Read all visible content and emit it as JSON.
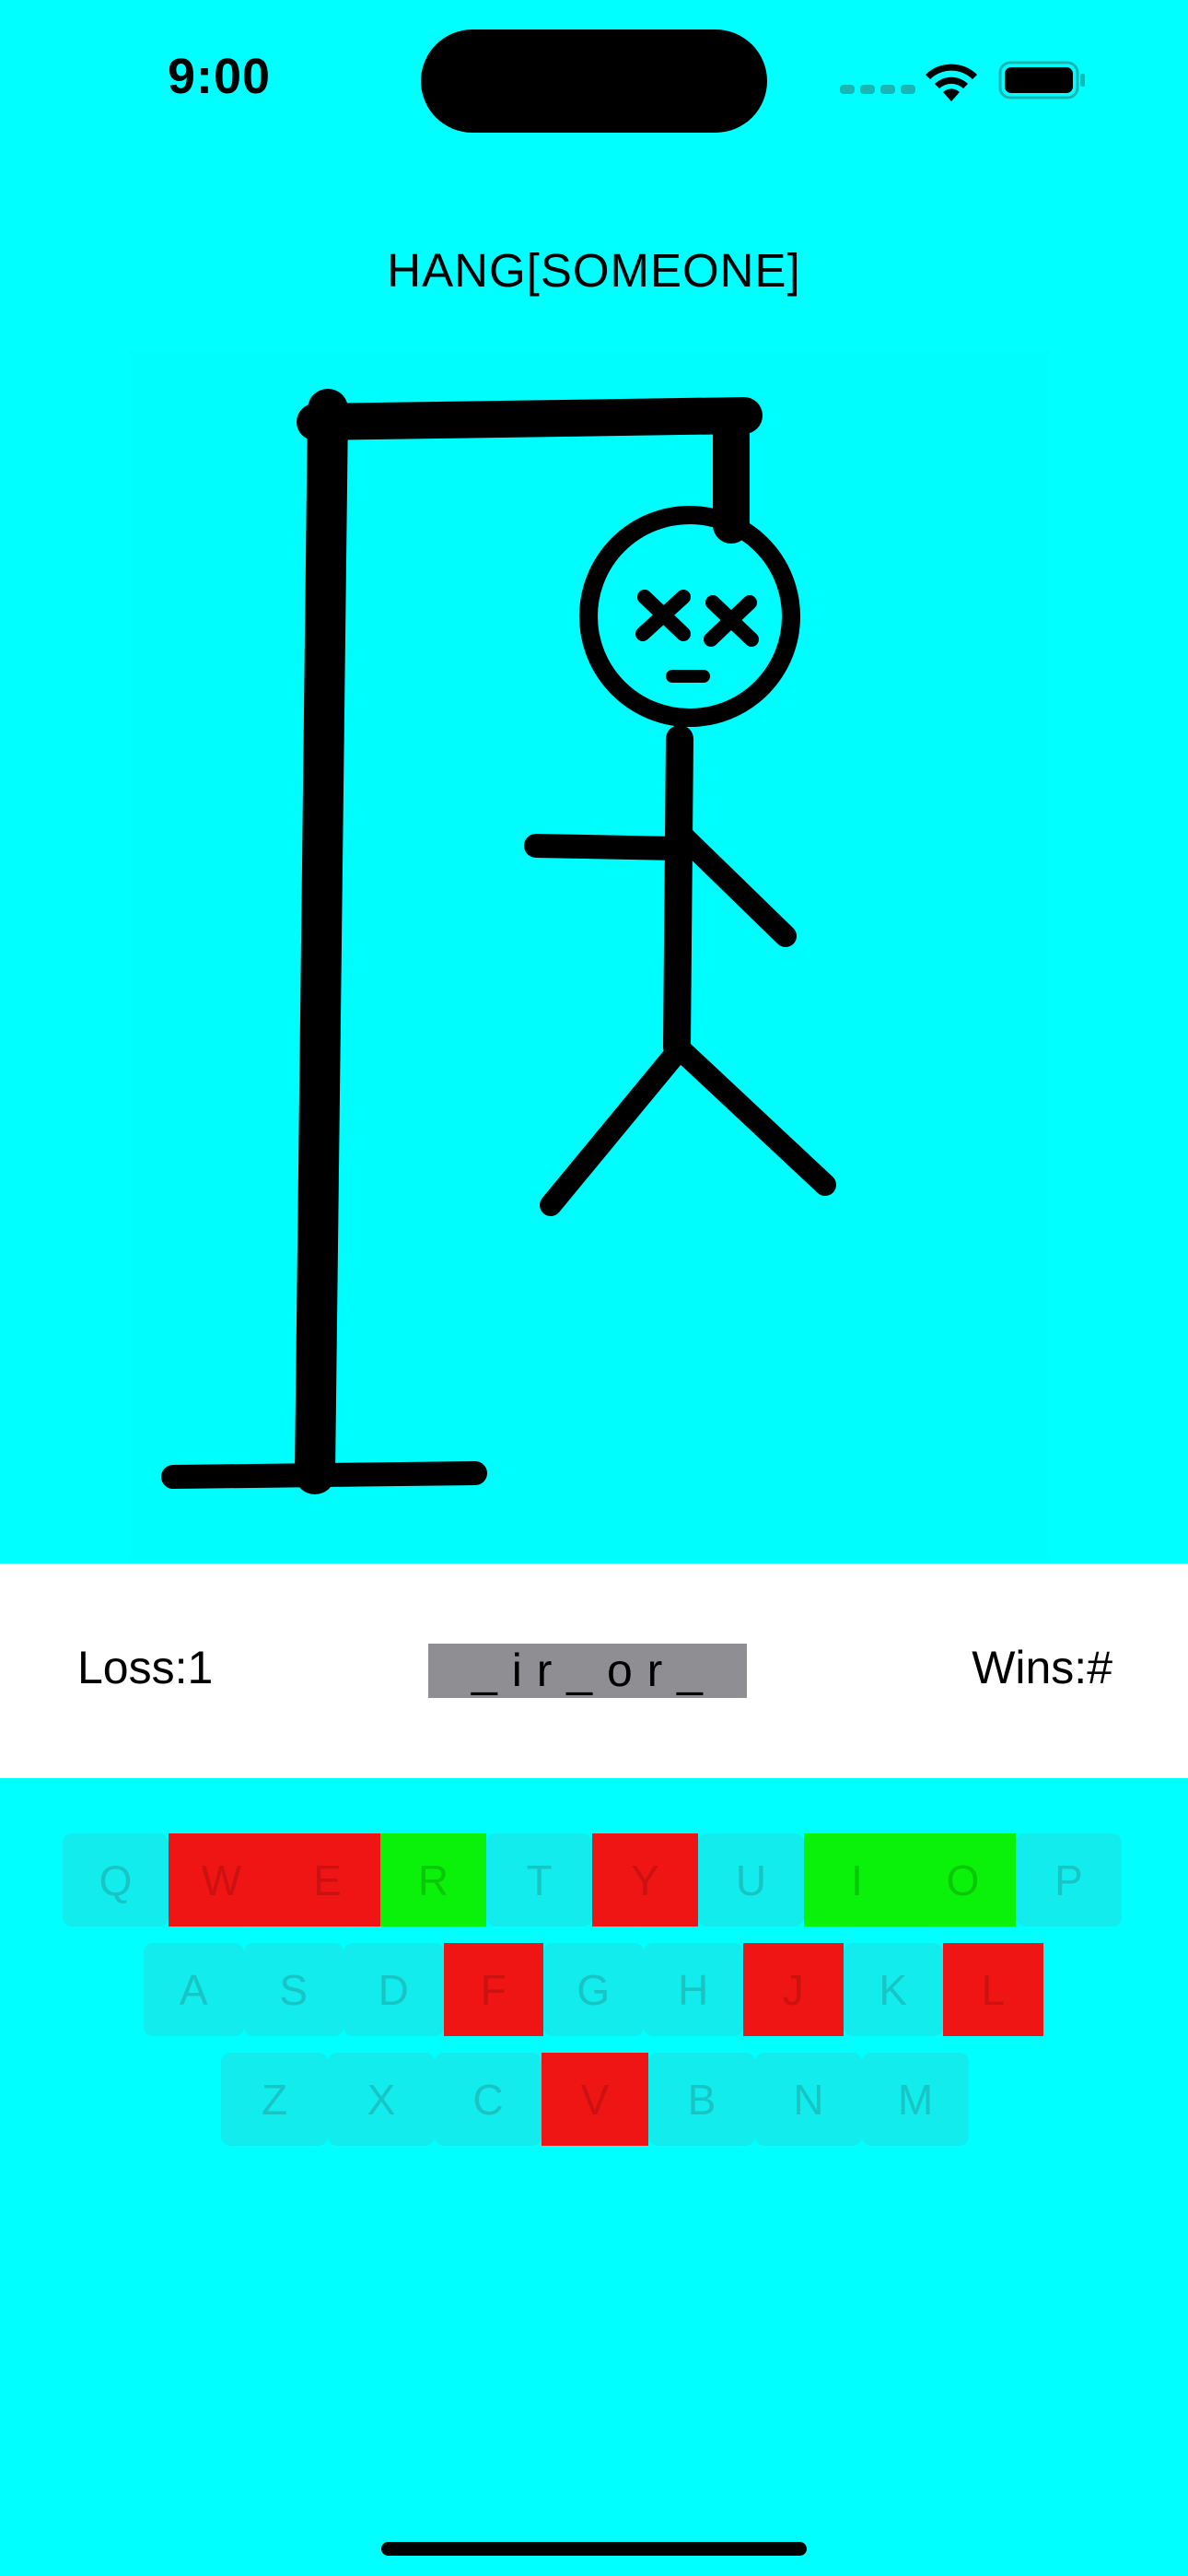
{
  "status_bar": {
    "time": "9:00"
  },
  "title": "HANG[SOMEONE]",
  "score": {
    "loss_label": "Loss:1",
    "wins_label": "Wins:#",
    "word": "_ i r _ o r _"
  },
  "keyboard": {
    "rows": [
      [
        {
          "letter": "Q",
          "state": "unused"
        },
        {
          "letter": "W",
          "state": "wrong"
        },
        {
          "letter": "E",
          "state": "wrong"
        },
        {
          "letter": "R",
          "state": "right"
        },
        {
          "letter": "T",
          "state": "unused"
        },
        {
          "letter": "Y",
          "state": "wrong"
        },
        {
          "letter": "U",
          "state": "unused"
        },
        {
          "letter": "I",
          "state": "right"
        },
        {
          "letter": "O",
          "state": "right"
        },
        {
          "letter": "P",
          "state": "unused"
        }
      ],
      [
        {
          "letter": "A",
          "state": "unused"
        },
        {
          "letter": "S",
          "state": "unused"
        },
        {
          "letter": "D",
          "state": "unused"
        },
        {
          "letter": "F",
          "state": "wrong"
        },
        {
          "letter": "G",
          "state": "unused"
        },
        {
          "letter": "H",
          "state": "unused"
        },
        {
          "letter": "J",
          "state": "wrong"
        },
        {
          "letter": "K",
          "state": "unused"
        },
        {
          "letter": "L",
          "state": "wrong"
        }
      ],
      [
        {
          "letter": "Z",
          "state": "unused"
        },
        {
          "letter": "X",
          "state": "unused"
        },
        {
          "letter": "C",
          "state": "unused"
        },
        {
          "letter": "V",
          "state": "wrong"
        },
        {
          "letter": "B",
          "state": "unused"
        },
        {
          "letter": "N",
          "state": "unused"
        },
        {
          "letter": "M",
          "state": "unused"
        }
      ]
    ]
  },
  "colors": {
    "background": "#00ffff",
    "wrong": "#ef1515",
    "right": "#0af20a",
    "unused_key": "#12ecec",
    "word_background": "#8e8e93"
  }
}
